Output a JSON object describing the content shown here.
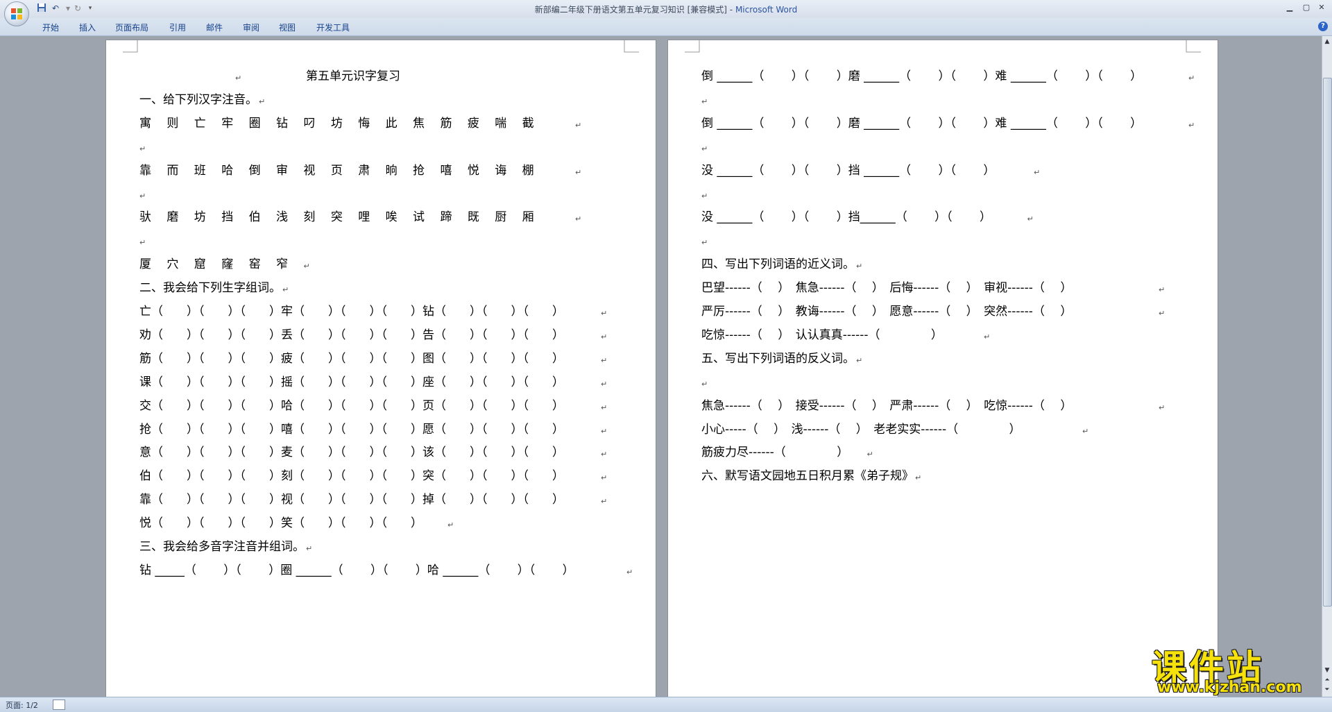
{
  "window": {
    "title": "新部编二年级下册语文第五单元复习知识 [兼容模式]",
    "app_name": "Microsoft Word",
    "quick_access": [
      "save-icon",
      "undo-icon",
      "redo-icon",
      "customize-icon"
    ],
    "controls": [
      "minimize-icon",
      "maximize-icon",
      "close-icon"
    ]
  },
  "ribbon_tabs": [
    "开始",
    "插入",
    "页面布局",
    "引用",
    "邮件",
    "审阅",
    "视图",
    "开发工具"
  ],
  "page1": [
    "第五单元识字复习",
    "一、给下列汉字注音。",
    "寓　 则　 亡　 牢　 圈　 钻　 叼　 坊　 悔　 此　 焦　 筋　 疲　 喘　 截",
    "",
    "靠　 而　 班　 哈　 倒　 审　 视　 页　 肃　 晌　 抢　 嘻　 悦　 诲　 棚",
    "",
    "驮　 磨　 坊　 挡　 伯　 浅　 刻　 突　 哩　 唉　 试　 蹄　 既　 厨　 厢",
    "",
    "厦　 穴　 窟　 窿　 窑　 窄",
    "二、我会给下列生字组词。",
    "亡（　　）（　　）（　　）牢（　　）（　　）（　　）钻（　　）（　　）（　　）",
    "劝（　　）（　　）（　　）丢（　　）（　　）（　　）告（　　）（　　）（　　）",
    "筋（　　）（　　）（　　）疲（　　）（　　）（　　）图（　　）（　　）（　　）",
    "课（　　）（　　）（　　）摇（　　）（　　）（　　）座（　　）（　　）（　　）",
    "交（　　）（　　）（　　）哈（　　）（　　）（　　）页（　　）（　　）（　　）",
    "抢（　　）（　　）（　　）嘻（　　）（　　）（　　）愿（　　）（　　）（　　）",
    "意（　　）（　　）（　　）麦（　　）（　　）（　　）该（　　）（　　）（　　）",
    "伯（　　）（　　）（　　）刻（　　）（　　）（　　）突（　　）（　　）（　　）",
    "靠（　　）（　　）（　　）视（　　）（　　）（　　）掉（　　）（　　）（　　）",
    "悦（　　）（　　）（　　）笑（　　）（　　）（　　）",
    "三、我会给多音字注音并组词。",
    "钻 _____（　　 ）（　　 ）圈 ______（　　 ）（　　 ）哈 ______（　　 ）（　　 ）"
  ],
  "page2": [
    "倒 ______（　　 ）（　　 ）磨 ______（　　 ）（　　 ）难 ______（　　 ）（　　 ）",
    "",
    "倒 ______（　　 ）（　　 ）磨 ______（　　 ）（　　 ）难 ______（　　 ）（　　 ）",
    "",
    "没 ______（　　 ）（　　 ）挡 ______（　　 ）（　　 ）",
    "",
    "没 ______（　　 ）（　　 ）挡______（　　 ）（　　 ）",
    "",
    "四、写出下列词语的近义词。",
    "巴望------（　 ）　焦急------（　 ）　后悔------（　 ）　审视------（　 ）",
    "严厉------（　 ）　教诲------（　 ）　愿意------（　 ）　突然------（　 ）",
    "吃惊------（　 ）　认认真真------（　　　　 ）",
    "五、写出下列词语的反义词。",
    "",
    "焦急------（　 ）　接受------（　 ）　严肃------（　 ）　吃惊------（　 ）",
    "小心-----（　 ）　浅------（　 ）　老老实实------（　　　　 ）",
    "筋疲力尽------（　　　　 ）",
    "六、默写语文园地五日积月累《弟子规》"
  ],
  "status": {
    "page": "页面: 1/2"
  },
  "watermark": {
    "main": "课件站",
    "url": "www.kjzhan.com"
  }
}
